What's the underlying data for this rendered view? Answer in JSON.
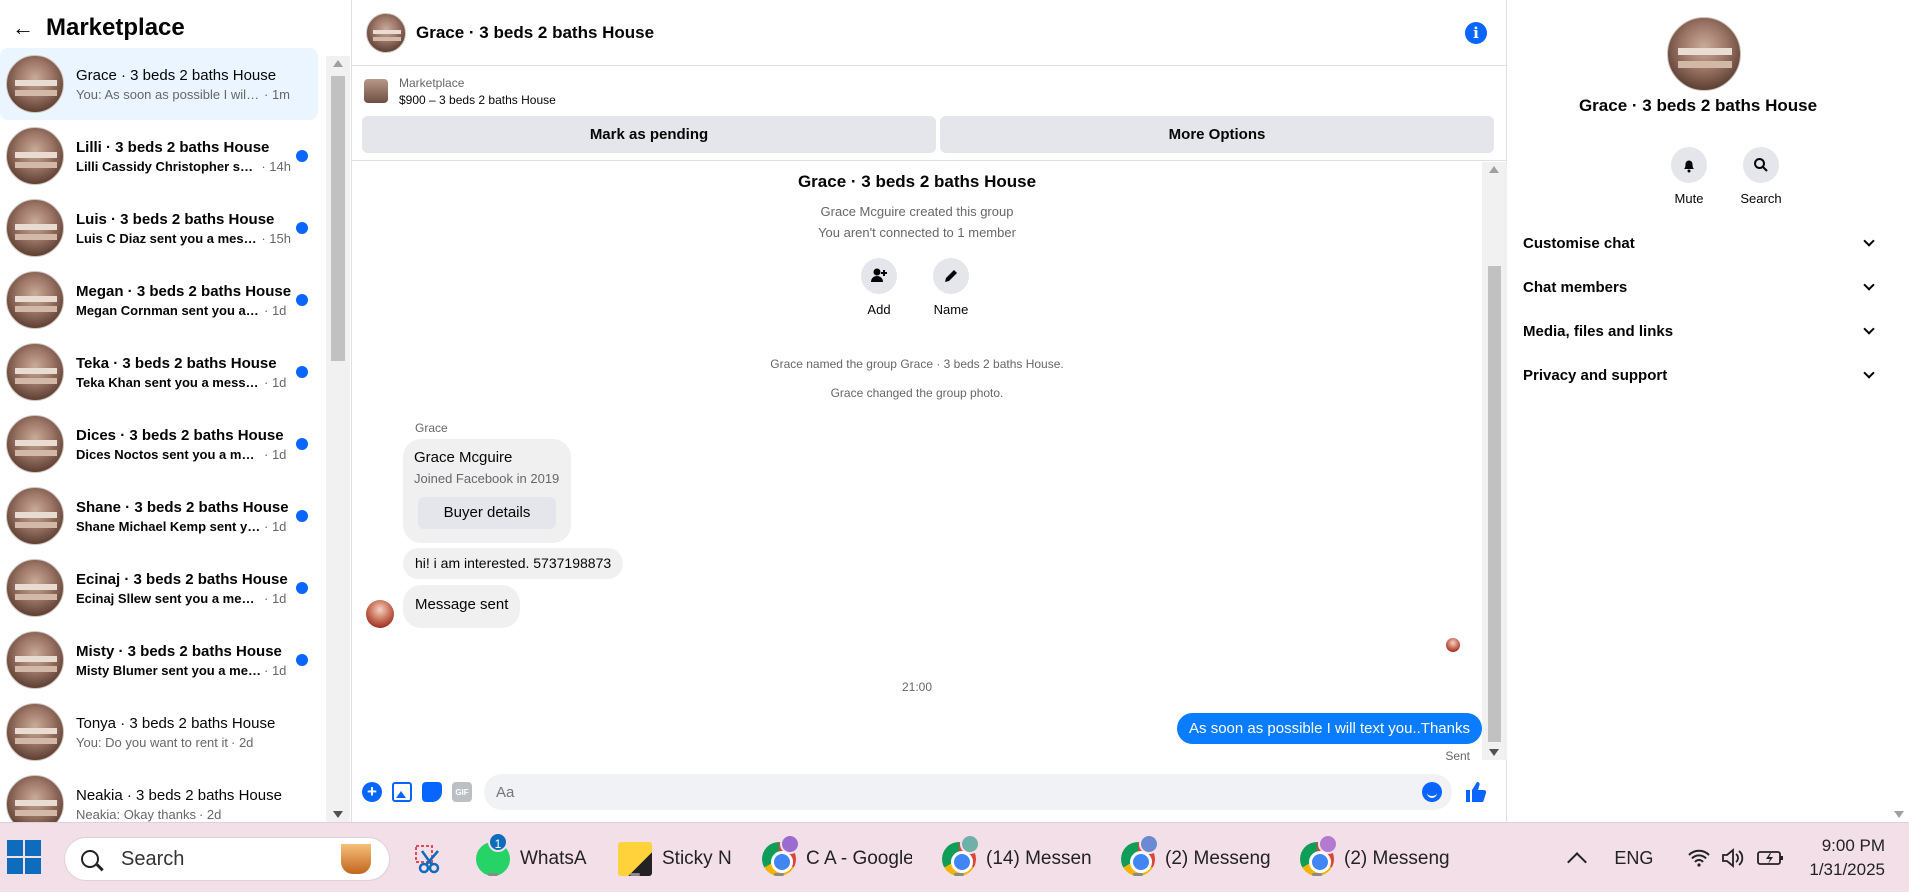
{
  "sidebar": {
    "title": "Marketplace",
    "conversations": [
      {
        "name": "Grace · 3 beds 2 baths House",
        "preview": "You: As soon as possible I will te...",
        "time": "· 1m"
      },
      {
        "name": "Lilli · 3 beds 2 baths House",
        "preview": "Lilli Cassidy Christopher sent ...",
        "time": "· 14h"
      },
      {
        "name": "Luis · 3 beds 2 baths House",
        "preview": "Luis C Diaz sent you a messa...",
        "time": "· 15h"
      },
      {
        "name": "Megan · 3 beds 2 baths House",
        "preview": "Megan Cornman sent you a m...",
        "time": "· 1d"
      },
      {
        "name": "Teka · 3 beds 2 baths House",
        "preview": "Teka Khan sent you a message...",
        "time": "· 1d"
      },
      {
        "name": "Dices · 3 beds 2 baths House",
        "preview": "Dices Noctos sent you a mess...",
        "time": "· 1d"
      },
      {
        "name": "Shane · 3 beds 2 baths House",
        "preview": "Shane Michael Kemp sent you...",
        "time": "· 1d"
      },
      {
        "name": "Ecinaj · 3 beds 2 baths House",
        "preview": "Ecinaj Sllew sent you a messag...",
        "time": "· 1d"
      },
      {
        "name": "Misty · 3 beds 2 baths House",
        "preview": "Misty Blumer sent you a mess...",
        "time": "· 1d"
      },
      {
        "name": "Tonya · 3 beds 2 baths House",
        "preview": "You: Do you want to rent it",
        "time": "· 2d"
      },
      {
        "name": "Neakia · 3 beds 2 baths House",
        "preview": "Neakia: Okay thanks",
        "time": "· 2d"
      }
    ]
  },
  "chat": {
    "header_title": "Grace · 3 beds 2 baths House",
    "listing": {
      "source": "Marketplace",
      "price_title": "$900 – 3 beds 2 baths House",
      "pending_label": "Mark as pending",
      "more_label": "More Options"
    },
    "group_title": "Grace · 3 beds 2 baths House",
    "created_by": "Grace Mcguire created this group",
    "not_connected": "You aren't connected to 1 member",
    "add_label": "Add",
    "name_label": "Name",
    "system_named": "Grace named the group Grace · 3 beds 2 baths House.",
    "system_photo": "Grace changed the group photo.",
    "sender_name": "Grace",
    "profile_card": {
      "name": "Grace Mcguire",
      "joined": "Joined Facebook in 2019",
      "button": "Buyer details"
    },
    "message_interested": "hi! i am interested. 5737198873",
    "message_sent": "Message sent",
    "time_separator": "21:00",
    "my_message": "As soon as possible I will text you..Thanks",
    "my_message_status": "Sent",
    "composer_placeholder": "Aa",
    "gif_label": "GIF"
  },
  "details": {
    "title": "Grace · 3 beds 2 baths House",
    "mute_label": "Mute",
    "search_label": "Search",
    "sections": [
      "Customise chat",
      "Chat members",
      "Media, files and links",
      "Privacy and support"
    ]
  },
  "taskbar": {
    "search_label": "Search",
    "apps": [
      {
        "label": "WhatsA",
        "badge": "1"
      },
      {
        "label": "Sticky N"
      },
      {
        "label": "C A - Google"
      },
      {
        "label": "(14) Messeng"
      },
      {
        "label": "(2) Messeng"
      },
      {
        "label": "(2) Messeng"
      }
    ],
    "lang": "ENG",
    "time": "9:00 PM",
    "date": "1/31/2025"
  },
  "colors": {
    "accent": "#0866ff",
    "my_bubble": "#0a7cff",
    "active_conv": "#ebf5ff",
    "taskbar": "#f3dfe8"
  }
}
